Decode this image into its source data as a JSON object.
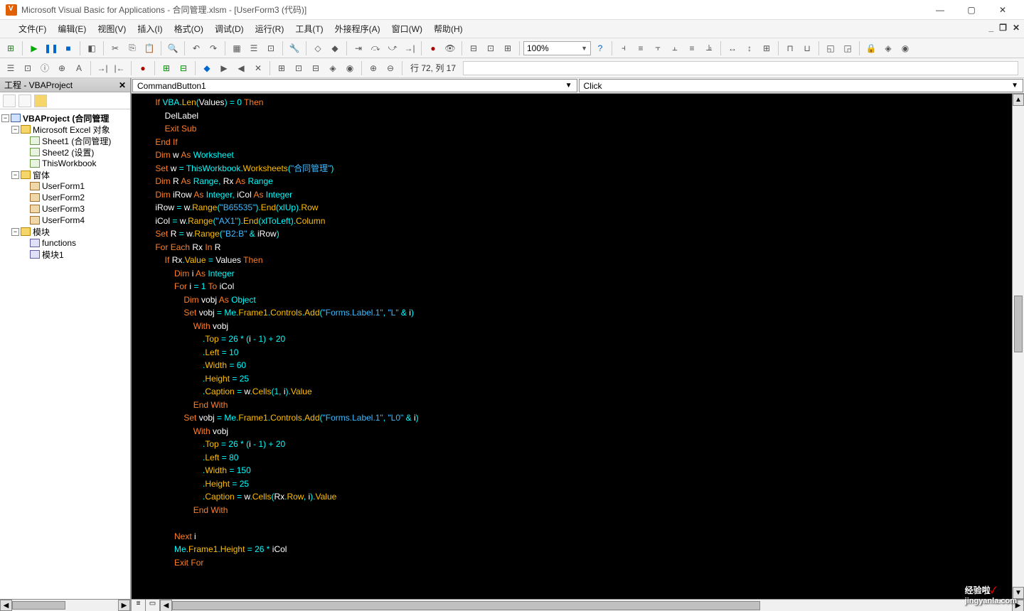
{
  "window": {
    "title": "Microsoft Visual Basic for Applications - 合同管理.xlsm - [UserForm3 (代码)]"
  },
  "menu": {
    "file": "文件(F)",
    "edit": "编辑(E)",
    "view": "视图(V)",
    "insert": "插入(I)",
    "format": "格式(O)",
    "debug": "调试(D)",
    "run": "运行(R)",
    "tools": "工具(T)",
    "addins": "外接程序(A)",
    "window": "窗口(W)",
    "help": "帮助(H)"
  },
  "toolbar": {
    "zoom": "100%",
    "cursor_pos": "行 72, 列 17"
  },
  "project_panel": {
    "title": "工程 - VBAProject",
    "root": "VBAProject (合同管理",
    "excel_folder": "Microsoft Excel 对象",
    "sheet1": "Sheet1 (合同管理)",
    "sheet2": "Sheet2 (设置)",
    "thiswb": "ThisWorkbook",
    "forms_folder": "窗体",
    "uf1": "UserForm1",
    "uf2": "UserForm2",
    "uf3": "UserForm3",
    "uf4": "UserForm4",
    "mod_folder": "模块",
    "mod_fn": "functions",
    "mod1": "模块1"
  },
  "dropdowns": {
    "object": "CommandButton1",
    "event": "Click"
  },
  "code_tokens": [
    [
      [
        "    ",
        ""
      ],
      [
        "If",
        "kw"
      ],
      [
        " ",
        "w"
      ],
      [
        "VBA",
        "ty"
      ],
      [
        ".",
        "op"
      ],
      [
        "Len",
        "fn"
      ],
      [
        "(",
        "op"
      ],
      [
        "Values",
        "id"
      ],
      [
        ")",
        "op"
      ],
      [
        " = ",
        "op"
      ],
      [
        "0",
        "nu"
      ],
      [
        " ",
        "w"
      ],
      [
        "Then",
        "kw"
      ]
    ],
    [
      [
        "        ",
        ""
      ],
      [
        "DelLabel",
        "ca"
      ]
    ],
    [
      [
        "        ",
        ""
      ],
      [
        "Exit",
        "kw"
      ],
      [
        " ",
        "w"
      ],
      [
        "Sub",
        "kw"
      ]
    ],
    [
      [
        "    ",
        ""
      ],
      [
        "End",
        "kw"
      ],
      [
        " ",
        "w"
      ],
      [
        "If",
        "kw"
      ]
    ],
    [
      [
        "    ",
        ""
      ],
      [
        "Dim",
        "kw"
      ],
      [
        " ",
        "w"
      ],
      [
        "w",
        "id"
      ],
      [
        " ",
        "w"
      ],
      [
        "As",
        "kw"
      ],
      [
        " ",
        "w"
      ],
      [
        "Worksheet",
        "ty"
      ]
    ],
    [
      [
        "    ",
        ""
      ],
      [
        "Set",
        "kw"
      ],
      [
        " ",
        "w"
      ],
      [
        "w",
        "id"
      ],
      [
        " = ",
        "op"
      ],
      [
        "ThisWorkbook",
        "ty"
      ],
      [
        ".",
        "op"
      ],
      [
        "Worksheets",
        "fn"
      ],
      [
        "(",
        "op"
      ],
      [
        "\"合同管理\"",
        "st"
      ],
      [
        ")",
        "op"
      ]
    ],
    [
      [
        "    ",
        ""
      ],
      [
        "Dim",
        "kw"
      ],
      [
        " ",
        "w"
      ],
      [
        "R",
        "id"
      ],
      [
        " ",
        "w"
      ],
      [
        "As",
        "kw"
      ],
      [
        " ",
        "w"
      ],
      [
        "Range",
        "ty"
      ],
      [
        ", ",
        "op"
      ],
      [
        "Rx",
        "id"
      ],
      [
        " ",
        "w"
      ],
      [
        "As",
        "kw"
      ],
      [
        " ",
        "w"
      ],
      [
        "Range",
        "ty"
      ]
    ],
    [
      [
        "    ",
        ""
      ],
      [
        "Dim",
        "kw"
      ],
      [
        " ",
        "w"
      ],
      [
        "iRow",
        "id"
      ],
      [
        " ",
        "w"
      ],
      [
        "As",
        "kw"
      ],
      [
        " ",
        "w"
      ],
      [
        "Integer",
        "ty"
      ],
      [
        ", ",
        "op"
      ],
      [
        "iCol",
        "id"
      ],
      [
        " ",
        "w"
      ],
      [
        "As",
        "kw"
      ],
      [
        " ",
        "w"
      ],
      [
        "Integer",
        "ty"
      ]
    ],
    [
      [
        "    ",
        ""
      ],
      [
        "iRow",
        "id"
      ],
      [
        " = ",
        "op"
      ],
      [
        "w",
        "id"
      ],
      [
        ".",
        "op"
      ],
      [
        "Range",
        "fn"
      ],
      [
        "(",
        "op"
      ],
      [
        "\"B65535\"",
        "st"
      ],
      [
        ").",
        "op"
      ],
      [
        "End",
        "fn"
      ],
      [
        "(",
        "op"
      ],
      [
        "xlUp",
        "ty"
      ],
      [
        ").",
        "op"
      ],
      [
        "Row",
        "mb"
      ]
    ],
    [
      [
        "    ",
        ""
      ],
      [
        "iCol",
        "id"
      ],
      [
        " = ",
        "op"
      ],
      [
        "w",
        "id"
      ],
      [
        ".",
        "op"
      ],
      [
        "Range",
        "fn"
      ],
      [
        "(",
        "op"
      ],
      [
        "\"AX1\"",
        "st"
      ],
      [
        ").",
        "op"
      ],
      [
        "End",
        "fn"
      ],
      [
        "(",
        "op"
      ],
      [
        "xlToLeft",
        "ty"
      ],
      [
        ").",
        "op"
      ],
      [
        "Column",
        "mb"
      ]
    ],
    [
      [
        "    ",
        ""
      ],
      [
        "Set",
        "kw"
      ],
      [
        " ",
        "w"
      ],
      [
        "R",
        "id"
      ],
      [
        " = ",
        "op"
      ],
      [
        "w",
        "id"
      ],
      [
        ".",
        "op"
      ],
      [
        "Range",
        "fn"
      ],
      [
        "(",
        "op"
      ],
      [
        "\"B2:B\"",
        "st"
      ],
      [
        " & ",
        "op"
      ],
      [
        "iRow",
        "id"
      ],
      [
        ")",
        "op"
      ]
    ],
    [
      [
        "    ",
        ""
      ],
      [
        "For",
        "kw"
      ],
      [
        " ",
        "w"
      ],
      [
        "Each",
        "kw"
      ],
      [
        " ",
        "w"
      ],
      [
        "Rx",
        "id"
      ],
      [
        " ",
        "w"
      ],
      [
        "In",
        "kw"
      ],
      [
        " ",
        "w"
      ],
      [
        "R",
        "id"
      ]
    ],
    [
      [
        "        ",
        ""
      ],
      [
        "If",
        "kw"
      ],
      [
        " ",
        "w"
      ],
      [
        "Rx",
        "id"
      ],
      [
        ".",
        "op"
      ],
      [
        "Value",
        "mb"
      ],
      [
        " = ",
        "op"
      ],
      [
        "Values",
        "id"
      ],
      [
        " ",
        "w"
      ],
      [
        "Then",
        "kw"
      ]
    ],
    [
      [
        "            ",
        ""
      ],
      [
        "Dim",
        "kw"
      ],
      [
        " ",
        "w"
      ],
      [
        "i",
        "id"
      ],
      [
        " ",
        "w"
      ],
      [
        "As",
        "kw"
      ],
      [
        " ",
        "w"
      ],
      [
        "Integer",
        "ty"
      ]
    ],
    [
      [
        "            ",
        ""
      ],
      [
        "For",
        "kw"
      ],
      [
        " ",
        "w"
      ],
      [
        "i",
        "id"
      ],
      [
        " = ",
        "op"
      ],
      [
        "1",
        "nu"
      ],
      [
        " ",
        "w"
      ],
      [
        "To",
        "kw"
      ],
      [
        " ",
        "w"
      ],
      [
        "iCol",
        "id"
      ]
    ],
    [
      [
        "                ",
        ""
      ],
      [
        "Dim",
        "kw"
      ],
      [
        " ",
        "w"
      ],
      [
        "vobj",
        "id"
      ],
      [
        " ",
        "w"
      ],
      [
        "As",
        "kw"
      ],
      [
        " ",
        "w"
      ],
      [
        "Object",
        "ty"
      ]
    ],
    [
      [
        "                ",
        ""
      ],
      [
        "Set",
        "kw"
      ],
      [
        " ",
        "w"
      ],
      [
        "vobj",
        "id"
      ],
      [
        " = ",
        "op"
      ],
      [
        "Me",
        "ty"
      ],
      [
        ".",
        "op"
      ],
      [
        "Frame1",
        "mb"
      ],
      [
        ".",
        "op"
      ],
      [
        "Controls",
        "mb"
      ],
      [
        ".",
        "op"
      ],
      [
        "Add",
        "fn"
      ],
      [
        "(",
        "op"
      ],
      [
        "\"Forms.Label.1\"",
        "st"
      ],
      [
        ", ",
        "op"
      ],
      [
        "\"L\"",
        "st"
      ],
      [
        " & ",
        "op"
      ],
      [
        "i",
        "id"
      ],
      [
        ")",
        "op"
      ]
    ],
    [
      [
        "                    ",
        ""
      ],
      [
        "With",
        "kw"
      ],
      [
        " ",
        "w"
      ],
      [
        "vobj",
        "id"
      ]
    ],
    [
      [
        "                        ",
        ""
      ],
      [
        ".",
        "op"
      ],
      [
        "Top",
        "mb"
      ],
      [
        " = ",
        "op"
      ],
      [
        "26",
        "nu"
      ],
      [
        " * (",
        "op"
      ],
      [
        "i",
        "id"
      ],
      [
        " - ",
        "op"
      ],
      [
        "1",
        "nu"
      ],
      [
        ") + ",
        "op"
      ],
      [
        "20",
        "nu"
      ]
    ],
    [
      [
        "                        ",
        ""
      ],
      [
        ".",
        "op"
      ],
      [
        "Left",
        "mb"
      ],
      [
        " = ",
        "op"
      ],
      [
        "10",
        "nu"
      ]
    ],
    [
      [
        "                        ",
        ""
      ],
      [
        ".",
        "op"
      ],
      [
        "Width",
        "mb"
      ],
      [
        " = ",
        "op"
      ],
      [
        "60",
        "nu"
      ]
    ],
    [
      [
        "                        ",
        ""
      ],
      [
        ".",
        "op"
      ],
      [
        "Height",
        "mb"
      ],
      [
        " = ",
        "op"
      ],
      [
        "25",
        "nu"
      ]
    ],
    [
      [
        "                        ",
        ""
      ],
      [
        ".",
        "op"
      ],
      [
        "Caption",
        "mb"
      ],
      [
        " = ",
        "op"
      ],
      [
        "w",
        "id"
      ],
      [
        ".",
        "op"
      ],
      [
        "Cells",
        "fn"
      ],
      [
        "(",
        "op"
      ],
      [
        "1",
        "nu"
      ],
      [
        ", ",
        "op"
      ],
      [
        "i",
        "id"
      ],
      [
        ").",
        "op"
      ],
      [
        "Value",
        "mb"
      ]
    ],
    [
      [
        "                    ",
        ""
      ],
      [
        "End",
        "kw"
      ],
      [
        " ",
        "w"
      ],
      [
        "With",
        "kw"
      ]
    ],
    [
      [
        "                ",
        ""
      ],
      [
        "Set",
        "kw"
      ],
      [
        " ",
        "w"
      ],
      [
        "vobj",
        "id"
      ],
      [
        " = ",
        "op"
      ],
      [
        "Me",
        "ty"
      ],
      [
        ".",
        "op"
      ],
      [
        "Frame1",
        "mb"
      ],
      [
        ".",
        "op"
      ],
      [
        "Controls",
        "mb"
      ],
      [
        ".",
        "op"
      ],
      [
        "Add",
        "fn"
      ],
      [
        "(",
        "op"
      ],
      [
        "\"Forms.Label.1\"",
        "st"
      ],
      [
        ", ",
        "op"
      ],
      [
        "\"L0\"",
        "st"
      ],
      [
        " & ",
        "op"
      ],
      [
        "i",
        "id"
      ],
      [
        ")",
        "op"
      ]
    ],
    [
      [
        "                    ",
        ""
      ],
      [
        "With",
        "kw"
      ],
      [
        " ",
        "w"
      ],
      [
        "vobj",
        "id"
      ]
    ],
    [
      [
        "                        ",
        ""
      ],
      [
        ".",
        "op"
      ],
      [
        "Top",
        "mb"
      ],
      [
        " = ",
        "op"
      ],
      [
        "26",
        "nu"
      ],
      [
        " * (",
        "op"
      ],
      [
        "i",
        "id"
      ],
      [
        " - ",
        "op"
      ],
      [
        "1",
        "nu"
      ],
      [
        ") + ",
        "op"
      ],
      [
        "20",
        "nu"
      ]
    ],
    [
      [
        "                        ",
        ""
      ],
      [
        ".",
        "op"
      ],
      [
        "Left",
        "mb"
      ],
      [
        " = ",
        "op"
      ],
      [
        "80",
        "nu"
      ]
    ],
    [
      [
        "                        ",
        ""
      ],
      [
        ".",
        "op"
      ],
      [
        "Width",
        "mb"
      ],
      [
        " = ",
        "op"
      ],
      [
        "150",
        "nu"
      ]
    ],
    [
      [
        "                        ",
        ""
      ],
      [
        ".",
        "op"
      ],
      [
        "Height",
        "mb"
      ],
      [
        " = ",
        "op"
      ],
      [
        "25",
        "nu"
      ]
    ],
    [
      [
        "                        ",
        ""
      ],
      [
        ".",
        "op"
      ],
      [
        "Caption",
        "mb"
      ],
      [
        " = ",
        "op"
      ],
      [
        "w",
        "id"
      ],
      [
        ".",
        "op"
      ],
      [
        "Cells",
        "fn"
      ],
      [
        "(",
        "op"
      ],
      [
        "Rx",
        "id"
      ],
      [
        ".",
        "op"
      ],
      [
        "Row",
        "mb"
      ],
      [
        ", ",
        "op"
      ],
      [
        "i",
        "id"
      ],
      [
        ").",
        "op"
      ],
      [
        "Value",
        "mb"
      ]
    ],
    [
      [
        "                    ",
        ""
      ],
      [
        "End",
        "kw"
      ],
      [
        " ",
        "w"
      ],
      [
        "With",
        "kw"
      ]
    ],
    [
      [
        "",
        ""
      ]
    ],
    [
      [
        "            ",
        ""
      ],
      [
        "Next",
        "kw"
      ],
      [
        " ",
        "w"
      ],
      [
        "i",
        "id"
      ]
    ],
    [
      [
        "            ",
        ""
      ],
      [
        "Me",
        "ty"
      ],
      [
        ".",
        "op"
      ],
      [
        "Frame1",
        "mb"
      ],
      [
        ".",
        "op"
      ],
      [
        "Height",
        "mb"
      ],
      [
        " = ",
        "op"
      ],
      [
        "26",
        "nu"
      ],
      [
        " * ",
        "op"
      ],
      [
        "iCol",
        "id"
      ]
    ],
    [
      [
        "            ",
        ""
      ],
      [
        "Exit",
        "kw"
      ],
      [
        " ",
        "w"
      ],
      [
        "For",
        "kw"
      ]
    ]
  ],
  "watermark": {
    "main": "经验啦",
    "check": "✓",
    "sub": "jingyanla.com"
  }
}
